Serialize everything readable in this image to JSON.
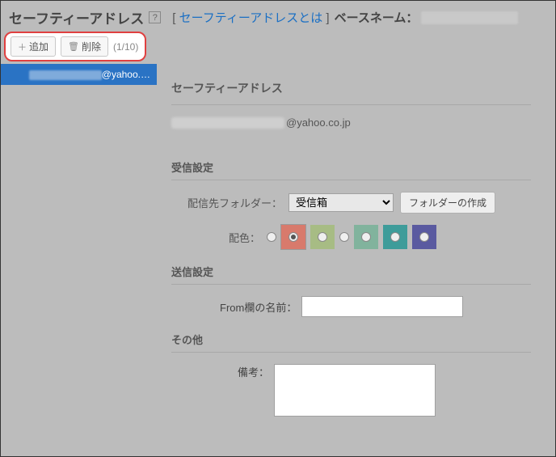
{
  "header": {
    "title": "セーフティーアドレス",
    "help_icon": "?",
    "link_text": "セーフティーアドレスとは",
    "basename_label": "ベースネーム："
  },
  "toolbar": {
    "add_label": "追加",
    "delete_label": "削除",
    "counter": "(1/10)"
  },
  "sidebar": {
    "selected_suffix": "@yahoo.…"
  },
  "detail": {
    "section_title": "セーフティーアドレス",
    "email_domain": "@yahoo.co.jp",
    "recv_section": "受信設定",
    "folder_label": "配信先フォルダー：",
    "folder_selected": "受信箱",
    "create_folder_label": "フォルダーの作成",
    "color_label": "配色：",
    "colors": [
      "#d87a6c",
      "#a7bc84",
      "#b39bbf",
      "#81b39d",
      "#3e9c9a",
      "#5a5aa0"
    ],
    "selected_color_index": 0,
    "send_section": "送信設定",
    "from_label": "From欄の名前：",
    "from_value": "",
    "other_section": "その他",
    "memo_label": "備考：",
    "memo_value": ""
  }
}
